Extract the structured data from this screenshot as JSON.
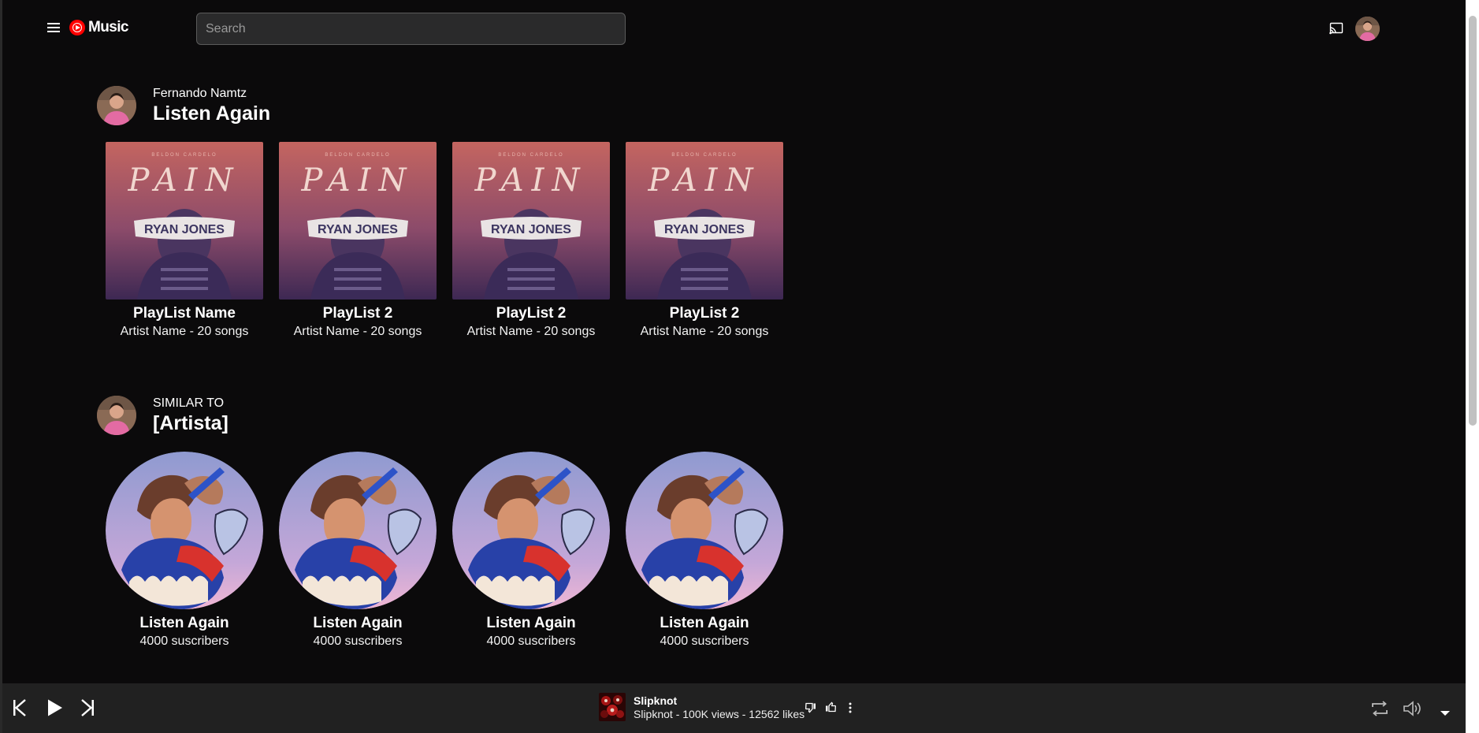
{
  "app": {
    "logo_text": "Music",
    "brand_color": "#ff0000",
    "background": "#0b0a0b"
  },
  "header": {
    "search_placeholder": "Search",
    "icons": [
      "menu-icon",
      "cast-icon",
      "avatar"
    ]
  },
  "sections": [
    {
      "subtitle": "Fernando Namtz",
      "title": "Listen Again",
      "cards": [
        {
          "title": "PlayList Name",
          "subtitle": "Artist Name - 20 songs"
        },
        {
          "title": "PlayList 2",
          "subtitle": "Artist Name - 20 songs"
        },
        {
          "title": "PlayList 2",
          "subtitle": "Artist Name - 20 songs"
        },
        {
          "title": "PlayList 2",
          "subtitle": "Artist Name - 20 songs"
        }
      ],
      "cover": {
        "top_text": "BELDON CARDELO",
        "word": "PAIN",
        "band": "RYAN JONES"
      }
    },
    {
      "subtitle": "SIMILAR TO",
      "title": "[Artista]",
      "cards": [
        {
          "title": "Listen Again",
          "subtitle": "4000 suscribers"
        },
        {
          "title": "Listen Again",
          "subtitle": "4000 suscribers"
        },
        {
          "title": "Listen Again",
          "subtitle": "4000 suscribers"
        },
        {
          "title": "Listen Again",
          "subtitle": "4000 suscribers"
        }
      ]
    }
  ],
  "player": {
    "track_title": "Slipknot",
    "track_meta": "Slipknot - 100K views - 12562 likes",
    "icons": [
      "skip-previous-icon",
      "play-icon",
      "skip-next-icon",
      "thumb-down-icon",
      "thumb-up-icon",
      "more-vert-icon",
      "repeat-icon",
      "volume-icon",
      "caret-down-icon"
    ]
  }
}
